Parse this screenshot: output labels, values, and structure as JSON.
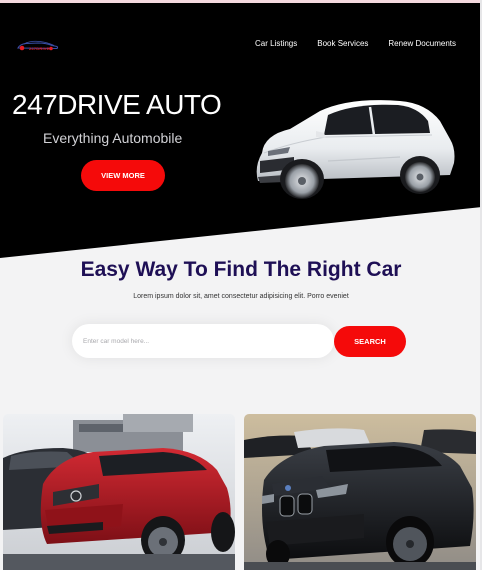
{
  "header": {
    "logo_text": "247DRIVE",
    "nav": [
      {
        "label": "Car Listings"
      },
      {
        "label": "Book Services"
      },
      {
        "label": "Renew Documents"
      }
    ]
  },
  "hero": {
    "title": "247DRIVE AUTO",
    "tagline": "Everything Automobile",
    "cta_label": "VIEW MORE",
    "image": "white-suv-photo"
  },
  "search": {
    "heading": "Easy Way To Find The Right Car",
    "subheading": "Lorem ipsum dolor sit, amet consectetur adipisicing elit. Porro eveniet",
    "placeholder": "Enter car model here...",
    "button_label": "SEARCH"
  },
  "listings": [
    {
      "image": "red-mercedes-suv-photo"
    },
    {
      "image": "black-bmw-suv-photo"
    }
  ],
  "colors": {
    "accent": "#f50a0a",
    "heading": "#1e0f55",
    "hero_bg": "#000000",
    "page_bg": "#f3f3f4"
  }
}
